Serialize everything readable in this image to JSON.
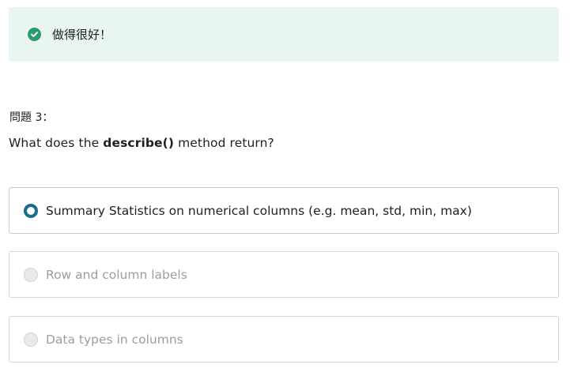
{
  "feedback": {
    "message": "做得很好！",
    "icon": "check-circle-icon",
    "color": "#2a9d6b"
  },
  "question": {
    "number_label": "問題 3：",
    "text_before": "What does the ",
    "text_bold": "describe()",
    "text_after": " method return?"
  },
  "options": [
    {
      "label": "Summary Statistics on numerical columns (e.g. mean, std, min, max)",
      "selected": true
    },
    {
      "label": "Row and column labels",
      "selected": false
    },
    {
      "label": "Data types in columns",
      "selected": false
    }
  ],
  "colors": {
    "accent": "#1a6e8a",
    "feedback_bg": "#e9f5ef"
  }
}
